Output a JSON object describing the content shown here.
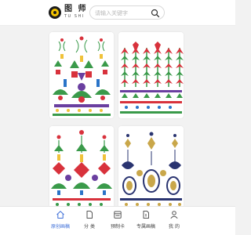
{
  "header": {
    "brand_cn": "图 师",
    "brand_en": "TU SHI",
    "search_placeholder": "请输入关键字"
  },
  "gallery": {
    "items": [
      {
        "icon": "pattern-thumbnail"
      },
      {
        "icon": "pattern-thumbnail"
      },
      {
        "icon": "pattern-thumbnail"
      },
      {
        "icon": "pattern-thumbnail"
      }
    ]
  },
  "tabbar": {
    "items": [
      {
        "label": "原创画稿",
        "icon": "home-icon",
        "active": true
      },
      {
        "label": "分 类",
        "icon": "file-icon"
      },
      {
        "label": "预制卡",
        "icon": "card-icon"
      },
      {
        "label": "专属画稿",
        "icon": "folder-icon"
      },
      {
        "label": "我 的",
        "icon": "user-icon"
      }
    ]
  },
  "colors": {
    "accent": "#3f6fd8",
    "background": "#f2f2f2",
    "pattern_red": "#d8323c",
    "pattern_green": "#3a9a4a",
    "pattern_purple": "#6a3fa0",
    "pattern_navy": "#2a3470",
    "pattern_gold": "#c9a74a"
  }
}
